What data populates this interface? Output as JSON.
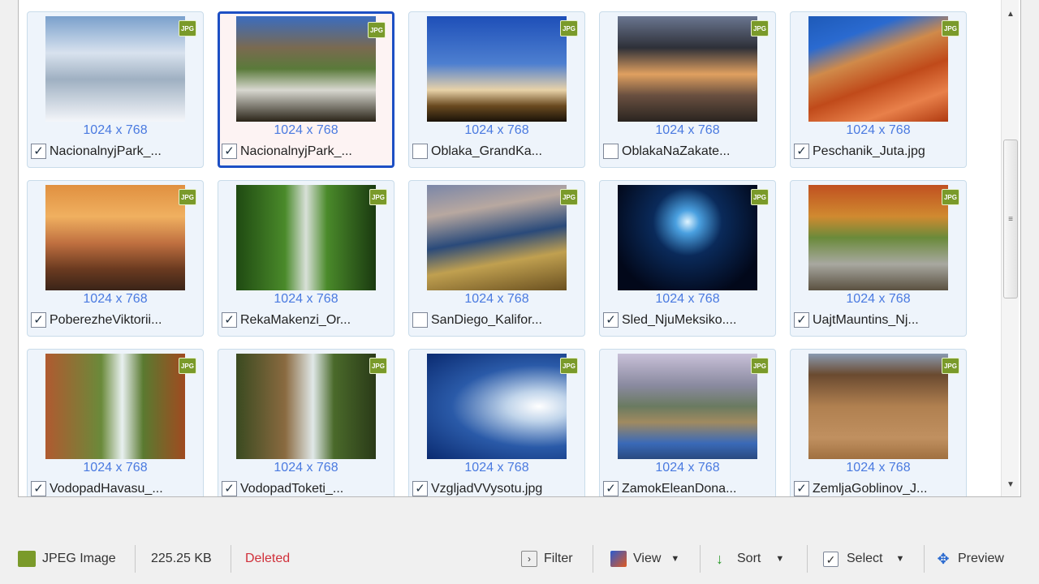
{
  "items": [
    {
      "name": "NacionalnyjPark_...",
      "dims": "1024 x 768",
      "checked": true,
      "selected": false,
      "thumb": "linear-gradient(180deg,#7aa0cc 0%,#d8e2ee 35%,#9fb0c2 60%,#f4f6fa 100%)"
    },
    {
      "name": "NacionalnyjPark_...",
      "dims": "1024 x 768",
      "checked": true,
      "selected": true,
      "thumb": "linear-gradient(180deg,#3a6cc0 0%,#7a6a50 30%,#5a7a3a 50%,#d8d8d0 70%,#2a2418 100%)"
    },
    {
      "name": "Oblaka_GrandKa...",
      "dims": "1024 x 768",
      "checked": false,
      "selected": false,
      "thumb": "linear-gradient(180deg,#1e4fb8 0%,#4d7fd0 45%,#e8d2a8 70%,#6a4a20 85%,#1a1208 100%)"
    },
    {
      "name": "OblakaNaZakate...",
      "dims": "1024 x 768",
      "checked": false,
      "selected": false,
      "thumb": "linear-gradient(180deg,#6a7690 0%,#2e3038 30%,#e0a060 55%,#6a5040 75%,#2a2420 100%)"
    },
    {
      "name": "Peschanik_Juta.jpg",
      "dims": "1024 x 768",
      "checked": true,
      "selected": false,
      "thumb": "linear-gradient(160deg,#1e5ab8 0%,#2a6ad0 22%,#d08a4a 40%,#c04a1a 60%,#e8804a 80%,#b03a10 100%)"
    },
    {
      "name": "PoberezheViktorii...",
      "dims": "1024 x 768",
      "checked": true,
      "selected": false,
      "thumb": "linear-gradient(180deg,#e09040 0%,#f0b060 30%,#c07040 55%,#6a3a20 80%,#3a2418 100%)"
    },
    {
      "name": "RekaMakenzi_Or...",
      "dims": "1024 x 768",
      "checked": true,
      "selected": false,
      "thumb": "linear-gradient(90deg,#1f4a12 0%,#4a8a2a 35%,#d8e0d8 50%,#4a8a2a 65%,#1a3a10 100%)"
    },
    {
      "name": "SanDiego_Kalifor...",
      "dims": "1024 x 768",
      "checked": false,
      "selected": false,
      "thumb": "linear-gradient(170deg,#7a86a8 0%,#b8a8a0 25%,#2a4a7a 50%,#c0a050 70%,#6a5020 100%)"
    },
    {
      "name": "Sled_NjuMeksiko....",
      "dims": "1024 x 768",
      "checked": true,
      "selected": false,
      "thumb": "radial-gradient(ellipse at 50% 35%,#dff4ff 0%,#4aa0e0 12%,#0a2a5a 35%,#02081a 80%)"
    },
    {
      "name": "UajtMauntins_Nj...",
      "dims": "1024 x 768",
      "checked": true,
      "selected": false,
      "thumb": "linear-gradient(180deg,#c05020 0%,#d08a30 30%,#6a8a3a 50%,#a8a8a0 75%,#5a5040 100%)"
    },
    {
      "name": "VodopadHavasu_...",
      "dims": "1024 x 768",
      "checked": true,
      "selected": false,
      "thumb": "linear-gradient(90deg,#b05a30 0%,#6a8a3a 40%,#e8f0f0 55%,#5a7a30 70%,#a04a20 100%)"
    },
    {
      "name": "VodopadToketi_...",
      "dims": "1024 x 768",
      "checked": true,
      "selected": false,
      "thumb": "linear-gradient(90deg,#3a4a20 0%,#8a6a40 35%,#e0e8e8 55%,#4a6a2a 70%,#2a3a18 100%)"
    },
    {
      "name": "VzgljadVVysotu.jpg",
      "dims": "1024 x 768",
      "checked": true,
      "selected": false,
      "thumb": "radial-gradient(ellipse at 80% 50%,#ffffff 0%,#c0d4ea 20%,#2a5aa8 55%,#0a2a70 100%)"
    },
    {
      "name": "ZamokEleanDona...",
      "dims": "1024 x 768",
      "checked": true,
      "selected": false,
      "thumb": "linear-gradient(180deg,#c8c0d8 0%,#8a8aa0 30%,#6a7a60 50%,#a08a60 65%,#3a6ab8 85%,#2a4a80 100%)"
    },
    {
      "name": "ZemljaGoblinov_J...",
      "dims": "1024 x 768",
      "checked": true,
      "selected": false,
      "thumb": "linear-gradient(180deg,#8a9ab0 0%,#6a4a30 20%,#b08050 50%,#c09060 80%,#a07040 100%)"
    }
  ],
  "badge": "JPG",
  "status": {
    "type": "JPEG Image",
    "size": "225.25 KB",
    "state": "Deleted",
    "state_color": "#d0303a"
  },
  "toolbar": {
    "filter": "Filter",
    "view": "View",
    "sort": "Sort",
    "select": "Select",
    "preview": "Preview"
  }
}
